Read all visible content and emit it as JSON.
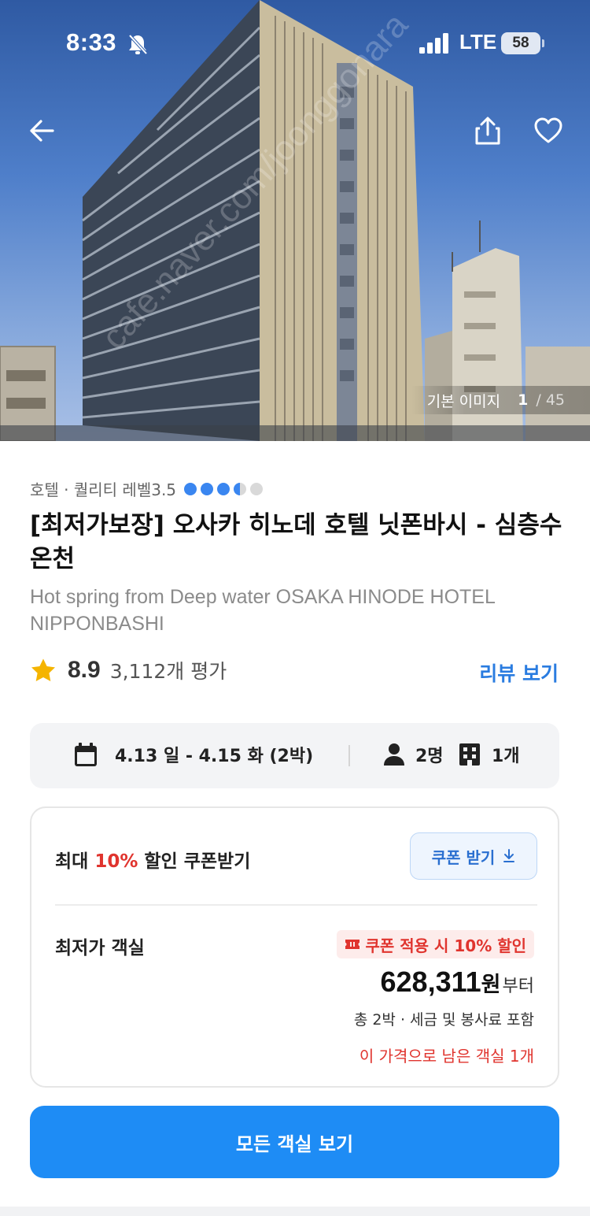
{
  "status_bar": {
    "time": "8:33",
    "network": "LTE",
    "battery": "58"
  },
  "hero": {
    "image_label": "기본 이미지",
    "image_index": "1",
    "image_total": "/ 45",
    "watermark": "cafe.naver.com/joonggonara"
  },
  "hotel": {
    "category": "호텔 · 퀄리티 레벨3.5",
    "quality_level": 3.5,
    "quality_max": 5,
    "title": "[최저가보장] 오사카 히노데 호텔 닛폰바시 - 심층수 온천",
    "subtitle": "Hot spring from Deep water OSAKA HINODE HOTEL NIPPONBASHI"
  },
  "rating": {
    "score": "8.9",
    "count": "3,112개 평가",
    "review_link": "리뷰 보기"
  },
  "search": {
    "dates": "4.13 일 - 4.15 화 (2박)",
    "guests": "2명",
    "rooms": "1개"
  },
  "price_card": {
    "coupon_prefix": "최대 ",
    "coupon_accent": "10%",
    "coupon_suffix": " 할인 쿠폰받기",
    "coupon_button": "쿠폰 받기",
    "lowest_label": "최저가 객실",
    "discount_badge": "쿠폰 적용 시 10% 할인",
    "price": "628,311",
    "price_unit": "원",
    "price_suffix": "부터",
    "tax_note": "총 2박 · 세금 및 봉사료 포함",
    "remaining": "이 가격으로 남은 객실 1개"
  },
  "cta": {
    "label": "모든 객실 보기"
  },
  "colors": {
    "accent_blue": "#1e8cf5",
    "link_blue": "#2a7ce0",
    "alert_red": "#e0342e",
    "star": "#f5b400"
  },
  "icons": [
    "back-arrow-icon",
    "share-icon",
    "heart-icon",
    "bell-off-icon",
    "signal-icon",
    "star-icon",
    "calendar-icon",
    "person-icon",
    "building-icon",
    "download-icon",
    "coupon-icon"
  ]
}
